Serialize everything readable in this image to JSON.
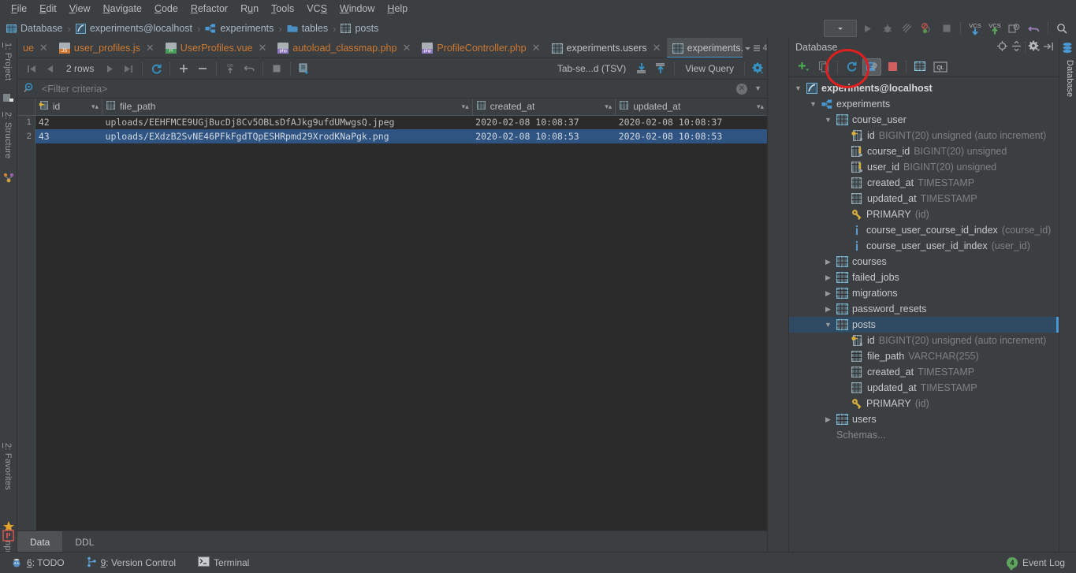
{
  "menu": {
    "items": [
      {
        "label": "File",
        "mnemonic": "F"
      },
      {
        "label": "Edit",
        "mnemonic": "E"
      },
      {
        "label": "View",
        "mnemonic": "V"
      },
      {
        "label": "Navigate",
        "mnemonic": "N"
      },
      {
        "label": "Code",
        "mnemonic": "C"
      },
      {
        "label": "Refactor",
        "mnemonic": "R"
      },
      {
        "label": "Run",
        "mnemonic": "u"
      },
      {
        "label": "Tools",
        "mnemonic": "T"
      },
      {
        "label": "VCS",
        "mnemonic": "S"
      },
      {
        "label": "Window",
        "mnemonic": "W"
      },
      {
        "label": "Help",
        "mnemonic": "H"
      }
    ]
  },
  "breadcrumb": {
    "items": [
      {
        "label": "Database",
        "icon": "database-folder-icon"
      },
      {
        "label": "experiments@localhost",
        "icon": "datasource-icon"
      },
      {
        "label": "experiments",
        "icon": "schema-icon"
      },
      {
        "label": "tables",
        "icon": "folder-icon"
      },
      {
        "label": "posts",
        "icon": "table-icon"
      }
    ],
    "separator": "›"
  },
  "main_toolbar": {
    "buttons": [
      {
        "name": "run-configurations-dropdown",
        "icon": "chevron-down-icon"
      },
      {
        "name": "run-button",
        "icon": "play-icon"
      },
      {
        "name": "debug-button",
        "icon": "bug-icon"
      },
      {
        "name": "coverage-button",
        "icon": "coverage-icon"
      },
      {
        "name": "stop-profiling-button",
        "icon": "profiler-icon"
      },
      {
        "name": "stop-button",
        "icon": "stop-square-icon"
      },
      {
        "name": "vcs-update-button",
        "icon": "vcs-update-icon",
        "label": "VCS"
      },
      {
        "name": "vcs-commit-button",
        "icon": "vcs-commit-icon",
        "label": "VCS"
      },
      {
        "name": "vcs-history-button",
        "icon": "vcs-history-icon"
      },
      {
        "name": "undo-button",
        "icon": "undo-icon"
      },
      {
        "name": "search-everywhere-button",
        "icon": "search-icon"
      }
    ]
  },
  "left_strip": {
    "tabs": [
      {
        "label": "1: Project",
        "mnemonic": "1"
      },
      {
        "label": "2: Structure",
        "mnemonic": "2"
      },
      {
        "label": "2: Favorites",
        "mnemonic": "2"
      },
      {
        "label": "npm",
        "mnemonic": ""
      }
    ]
  },
  "right_strip": {
    "label": "Database"
  },
  "editor_tabs": {
    "clipped_first": "ue",
    "tabs": [
      {
        "label": "user_profiles.js",
        "type": "js",
        "active": false
      },
      {
        "label": "UserProfiles.vue",
        "type": "vue",
        "active": false
      },
      {
        "label": "autoload_classmap.php",
        "type": "php",
        "active": false
      },
      {
        "label": "ProfileController.php",
        "type": "php",
        "active": false
      },
      {
        "label": "experiments.users",
        "type": "table",
        "active": false
      },
      {
        "label": "experiments.posts",
        "type": "table",
        "active": true
      }
    ],
    "overflow_count": "4"
  },
  "grid_toolbar": {
    "row_count": "2 rows",
    "format_label": "Tab-se...d (TSV)",
    "view_query_label": "View Query",
    "buttons": [
      {
        "name": "first-page-button",
        "icon": "skip-to-start-icon"
      },
      {
        "name": "previous-page-button",
        "icon": "previous-icon"
      },
      {
        "name": "next-page-button",
        "icon": "next-icon"
      },
      {
        "name": "last-page-button",
        "icon": "skip-to-end-icon"
      },
      {
        "name": "reload-page-button",
        "icon": "refresh-icon"
      },
      {
        "name": "add-row-button",
        "icon": "plus-icon"
      },
      {
        "name": "delete-row-button",
        "icon": "minus-icon"
      },
      {
        "name": "submit-to-db-button",
        "icon": "db-upload-icon"
      },
      {
        "name": "revert-changes-button",
        "icon": "undo-icon"
      },
      {
        "name": "cancel-query-button",
        "icon": "stop-square-icon"
      },
      {
        "name": "transaction-mode-button",
        "icon": "transaction-icon"
      },
      {
        "name": "export-data-button",
        "icon": "download-icon"
      },
      {
        "name": "import-data-button",
        "icon": "upload-icon"
      },
      {
        "name": "data-settings-button",
        "icon": "gear-icon"
      }
    ]
  },
  "filter_bar": {
    "placeholder": "<Filter criteria>",
    "icon": "filter-search-icon"
  },
  "table": {
    "columns": [
      {
        "name": "id",
        "icon": "primary-key-column-icon",
        "sortable": true
      },
      {
        "name": "file_path",
        "icon": "column-icon",
        "sortable": true
      },
      {
        "name": "created_at",
        "icon": "column-icon",
        "sortable": true
      },
      {
        "name": "updated_at",
        "icon": "column-icon",
        "sortable": true
      }
    ],
    "rows": [
      {
        "num": "1",
        "selected": false,
        "id": "42",
        "file_path": "uploads/EEHFMCE9UGjBucDj8Cv5OBLsDfAJkg9ufdUMwgsQ.jpeg",
        "created_at": "2020-02-08 10:08:37",
        "updated_at": "2020-02-08 10:08:37"
      },
      {
        "num": "2",
        "selected": true,
        "id": "43",
        "file_path": "uploads/EXdzB2SvNE46PFkFgdTQpESHRpmd29XrodKNaPgk.png",
        "created_at": "2020-02-08 10:08:53",
        "updated_at": "2020-02-08 10:08:53"
      }
    ]
  },
  "editor_bottom_tabs": [
    {
      "label": "Data",
      "active": true
    },
    {
      "label": "DDL",
      "active": false
    }
  ],
  "db_panel": {
    "title": "Database",
    "header_actions": [
      {
        "name": "expand-collapse-button",
        "icon": "target-icon"
      },
      {
        "name": "group-button",
        "icon": "collapse-all-icon"
      },
      {
        "name": "settings-button",
        "icon": "gear-icon"
      },
      {
        "name": "hide-button",
        "icon": "hide-panel-icon"
      }
    ],
    "toolbar": [
      {
        "name": "add-datasource-button",
        "icon": "plus-icon"
      },
      {
        "name": "duplicate-button",
        "icon": "copy-icon"
      },
      {
        "name": "refresh-button",
        "icon": "refresh-icon"
      },
      {
        "name": "data-source-properties-button",
        "icon": "wrench-icon",
        "pressed": true
      },
      {
        "name": "stop-button",
        "icon": "stop-square-icon"
      },
      {
        "name": "jump-to-console-button",
        "icon": "table-icon"
      },
      {
        "name": "open-query-console-button",
        "icon": "sql-console-icon"
      }
    ],
    "tree": [
      {
        "depth": 0,
        "twist": "▼",
        "icon": "datasource-icon",
        "label": "experiments@localhost",
        "meta": "",
        "bold": true,
        "selected": false
      },
      {
        "depth": 1,
        "twist": "▼",
        "icon": "schema-icon",
        "label": "experiments",
        "meta": "",
        "bold": false,
        "selected": false
      },
      {
        "depth": 2,
        "twist": "▼",
        "icon": "table-icon",
        "label": "course_user",
        "meta": "",
        "bold": false,
        "selected": false
      },
      {
        "depth": 3,
        "twist": "",
        "icon": "primary-key-column-icon",
        "label": "id",
        "meta": "BIGINT(20) unsigned (auto increment)",
        "bold": false,
        "selected": false
      },
      {
        "depth": 3,
        "twist": "",
        "icon": "indexed-column-icon",
        "label": "course_id",
        "meta": "BIGINT(20) unsigned",
        "bold": false,
        "selected": false
      },
      {
        "depth": 3,
        "twist": "",
        "icon": "indexed-column-icon",
        "label": "user_id",
        "meta": "BIGINT(20) unsigned",
        "bold": false,
        "selected": false
      },
      {
        "depth": 3,
        "twist": "",
        "icon": "column-icon",
        "label": "created_at",
        "meta": "TIMESTAMP",
        "bold": false,
        "selected": false
      },
      {
        "depth": 3,
        "twist": "",
        "icon": "column-icon",
        "label": "updated_at",
        "meta": "TIMESTAMP",
        "bold": false,
        "selected": false
      },
      {
        "depth": 3,
        "twist": "",
        "icon": "key-icon",
        "label": "PRIMARY",
        "meta": "(id)",
        "bold": false,
        "selected": false
      },
      {
        "depth": 3,
        "twist": "",
        "icon": "index-icon",
        "label": "course_user_course_id_index",
        "meta": "(course_id)",
        "bold": false,
        "selected": false
      },
      {
        "depth": 3,
        "twist": "",
        "icon": "index-icon",
        "label": "course_user_user_id_index",
        "meta": "(user_id)",
        "bold": false,
        "selected": false
      },
      {
        "depth": 2,
        "twist": "▶",
        "icon": "table-icon",
        "label": "courses",
        "meta": "",
        "bold": false,
        "selected": false
      },
      {
        "depth": 2,
        "twist": "▶",
        "icon": "table-icon",
        "label": "failed_jobs",
        "meta": "",
        "bold": false,
        "selected": false
      },
      {
        "depth": 2,
        "twist": "▶",
        "icon": "table-icon",
        "label": "migrations",
        "meta": "",
        "bold": false,
        "selected": false
      },
      {
        "depth": 2,
        "twist": "▶",
        "icon": "table-icon",
        "label": "password_resets",
        "meta": "",
        "bold": false,
        "selected": false
      },
      {
        "depth": 2,
        "twist": "▼",
        "icon": "table-icon",
        "label": "posts",
        "meta": "",
        "bold": false,
        "selected": true
      },
      {
        "depth": 3,
        "twist": "",
        "icon": "primary-key-column-icon",
        "label": "id",
        "meta": "BIGINT(20) unsigned (auto increment)",
        "bold": false,
        "selected": false
      },
      {
        "depth": 3,
        "twist": "",
        "icon": "column-icon",
        "label": "file_path",
        "meta": "VARCHAR(255)",
        "bold": false,
        "selected": false
      },
      {
        "depth": 3,
        "twist": "",
        "icon": "column-icon",
        "label": "created_at",
        "meta": "TIMESTAMP",
        "bold": false,
        "selected": false
      },
      {
        "depth": 3,
        "twist": "",
        "icon": "column-icon",
        "label": "updated_at",
        "meta": "TIMESTAMP",
        "bold": false,
        "selected": false
      },
      {
        "depth": 3,
        "twist": "",
        "icon": "key-icon",
        "label": "PRIMARY",
        "meta": "(id)",
        "bold": false,
        "selected": false
      },
      {
        "depth": 2,
        "twist": "▶",
        "icon": "table-icon",
        "label": "users",
        "meta": "",
        "bold": false,
        "selected": false
      },
      {
        "depth": 2,
        "twist": "",
        "icon": "",
        "label": "Schemas...",
        "meta": "",
        "bold": false,
        "selected": false
      }
    ]
  },
  "status_bar": {
    "items": [
      {
        "label": "6: TODO",
        "mnemonic": "6",
        "icon": "todo-icon"
      },
      {
        "label": "9: Version Control",
        "mnemonic": "9",
        "icon": "branch-icon"
      },
      {
        "label": "Terminal",
        "mnemonic": "",
        "icon": "terminal-icon"
      }
    ],
    "event_log": {
      "label": "Event Log",
      "count": "4"
    }
  },
  "annotation": {
    "shape": "circle",
    "color": "#e02020",
    "target": "data-source-properties-button"
  }
}
